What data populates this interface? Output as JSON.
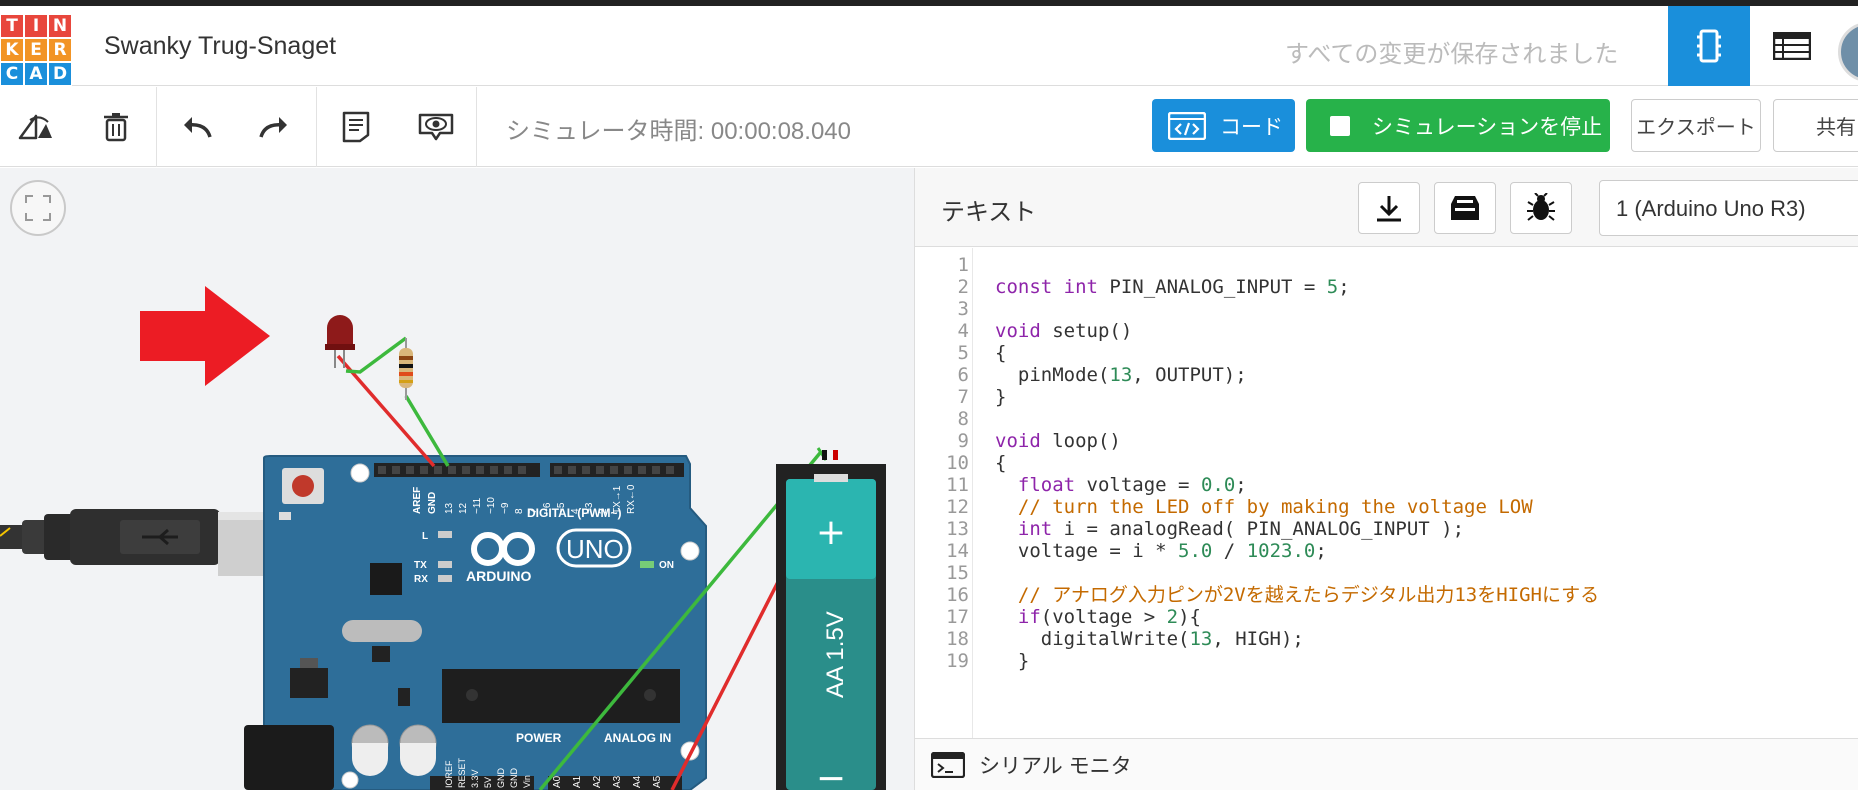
{
  "header": {
    "logo_letters": [
      "T",
      "I",
      "N",
      "K",
      "E",
      "R",
      "C",
      "A",
      "D"
    ],
    "logo_colors": [
      "#e8463c",
      "#e8463c",
      "#e8463c",
      "#f29425",
      "#f29425",
      "#f29425",
      "#1a8fdb",
      "#1a8fdb",
      "#1a8fdb"
    ],
    "project_title": "Swanky Trug-Snaget",
    "save_status": "すべての変更が保存されました"
  },
  "toolbar": {
    "sim_time": "シミュレータ時間: 00:00:08.040",
    "code_label": "コード",
    "stop_label": "シミュレーションを停止",
    "export_label": "エクスポート",
    "share_label": "共有"
  },
  "code_panel": {
    "mode": "テキスト",
    "board": "1 (Arduino Uno R3)",
    "serial_monitor": "シリアル モニタ",
    "lines": [
      {
        "n": "1",
        "t": ""
      },
      {
        "n": "2",
        "t": "const int PIN_ANALOG_INPUT = 5;"
      },
      {
        "n": "3",
        "t": ""
      },
      {
        "n": "4",
        "t": "void setup()"
      },
      {
        "n": "5",
        "t": "{"
      },
      {
        "n": "6",
        "t": "  pinMode(13, OUTPUT);"
      },
      {
        "n": "7",
        "t": "}"
      },
      {
        "n": "8",
        "t": ""
      },
      {
        "n": "9",
        "t": "void loop()"
      },
      {
        "n": "10",
        "t": "{"
      },
      {
        "n": "11",
        "t": "  float voltage = 0.0;"
      },
      {
        "n": "12",
        "t": "  // turn the LED off by making the voltage LOW"
      },
      {
        "n": "13",
        "t": "  int i = analogRead( PIN_ANALOG_INPUT );"
      },
      {
        "n": "14",
        "t": "  voltage = i * 5.0 / 1023.0;"
      },
      {
        "n": "15",
        "t": ""
      },
      {
        "n": "16",
        "t": "  // アナログ入力ピンが2Vを越えたらデジタル出力13をHIGHにする"
      },
      {
        "n": "17",
        "t": "  if(voltage > 2){"
      },
      {
        "n": "18",
        "t": "    digitalWrite(13, HIGH);"
      },
      {
        "n": "19",
        "t": "  }"
      }
    ]
  },
  "board_labels": {
    "brand": "ARDUINO",
    "model": "UNO",
    "digital": "DIGITAL (PWM~)",
    "power": "POWER",
    "analog": "ANALOG IN",
    "on": "ON",
    "l": "L",
    "tx": "TX",
    "rx": "RX",
    "aref": "AREF",
    "gnd": "GND",
    "pins_digital": [
      "13",
      "12",
      "~11",
      "~10",
      "~9",
      "8",
      "7",
      "~6",
      "~5",
      "4",
      "~3",
      "2",
      "TX→1",
      "RX←0"
    ],
    "pins_power": [
      "IOREF",
      "RESET",
      "3.3V",
      "5V",
      "GND",
      "GND",
      "Vin"
    ],
    "pins_analog": [
      "A0",
      "A1",
      "A2",
      "A3",
      "A4",
      "A5"
    ]
  },
  "battery": {
    "label": "AA 1.5V",
    "plus": "+",
    "minus": "−"
  },
  "colors": {
    "accent": "#1a8fdb",
    "stop_green": "#27b24a",
    "arduino_blue": "#2e6e99",
    "battery_teal": "#2bb5b0",
    "wire_red": "#e02c2c",
    "wire_green": "#3db93d",
    "arrow_red": "#ec1c24"
  }
}
